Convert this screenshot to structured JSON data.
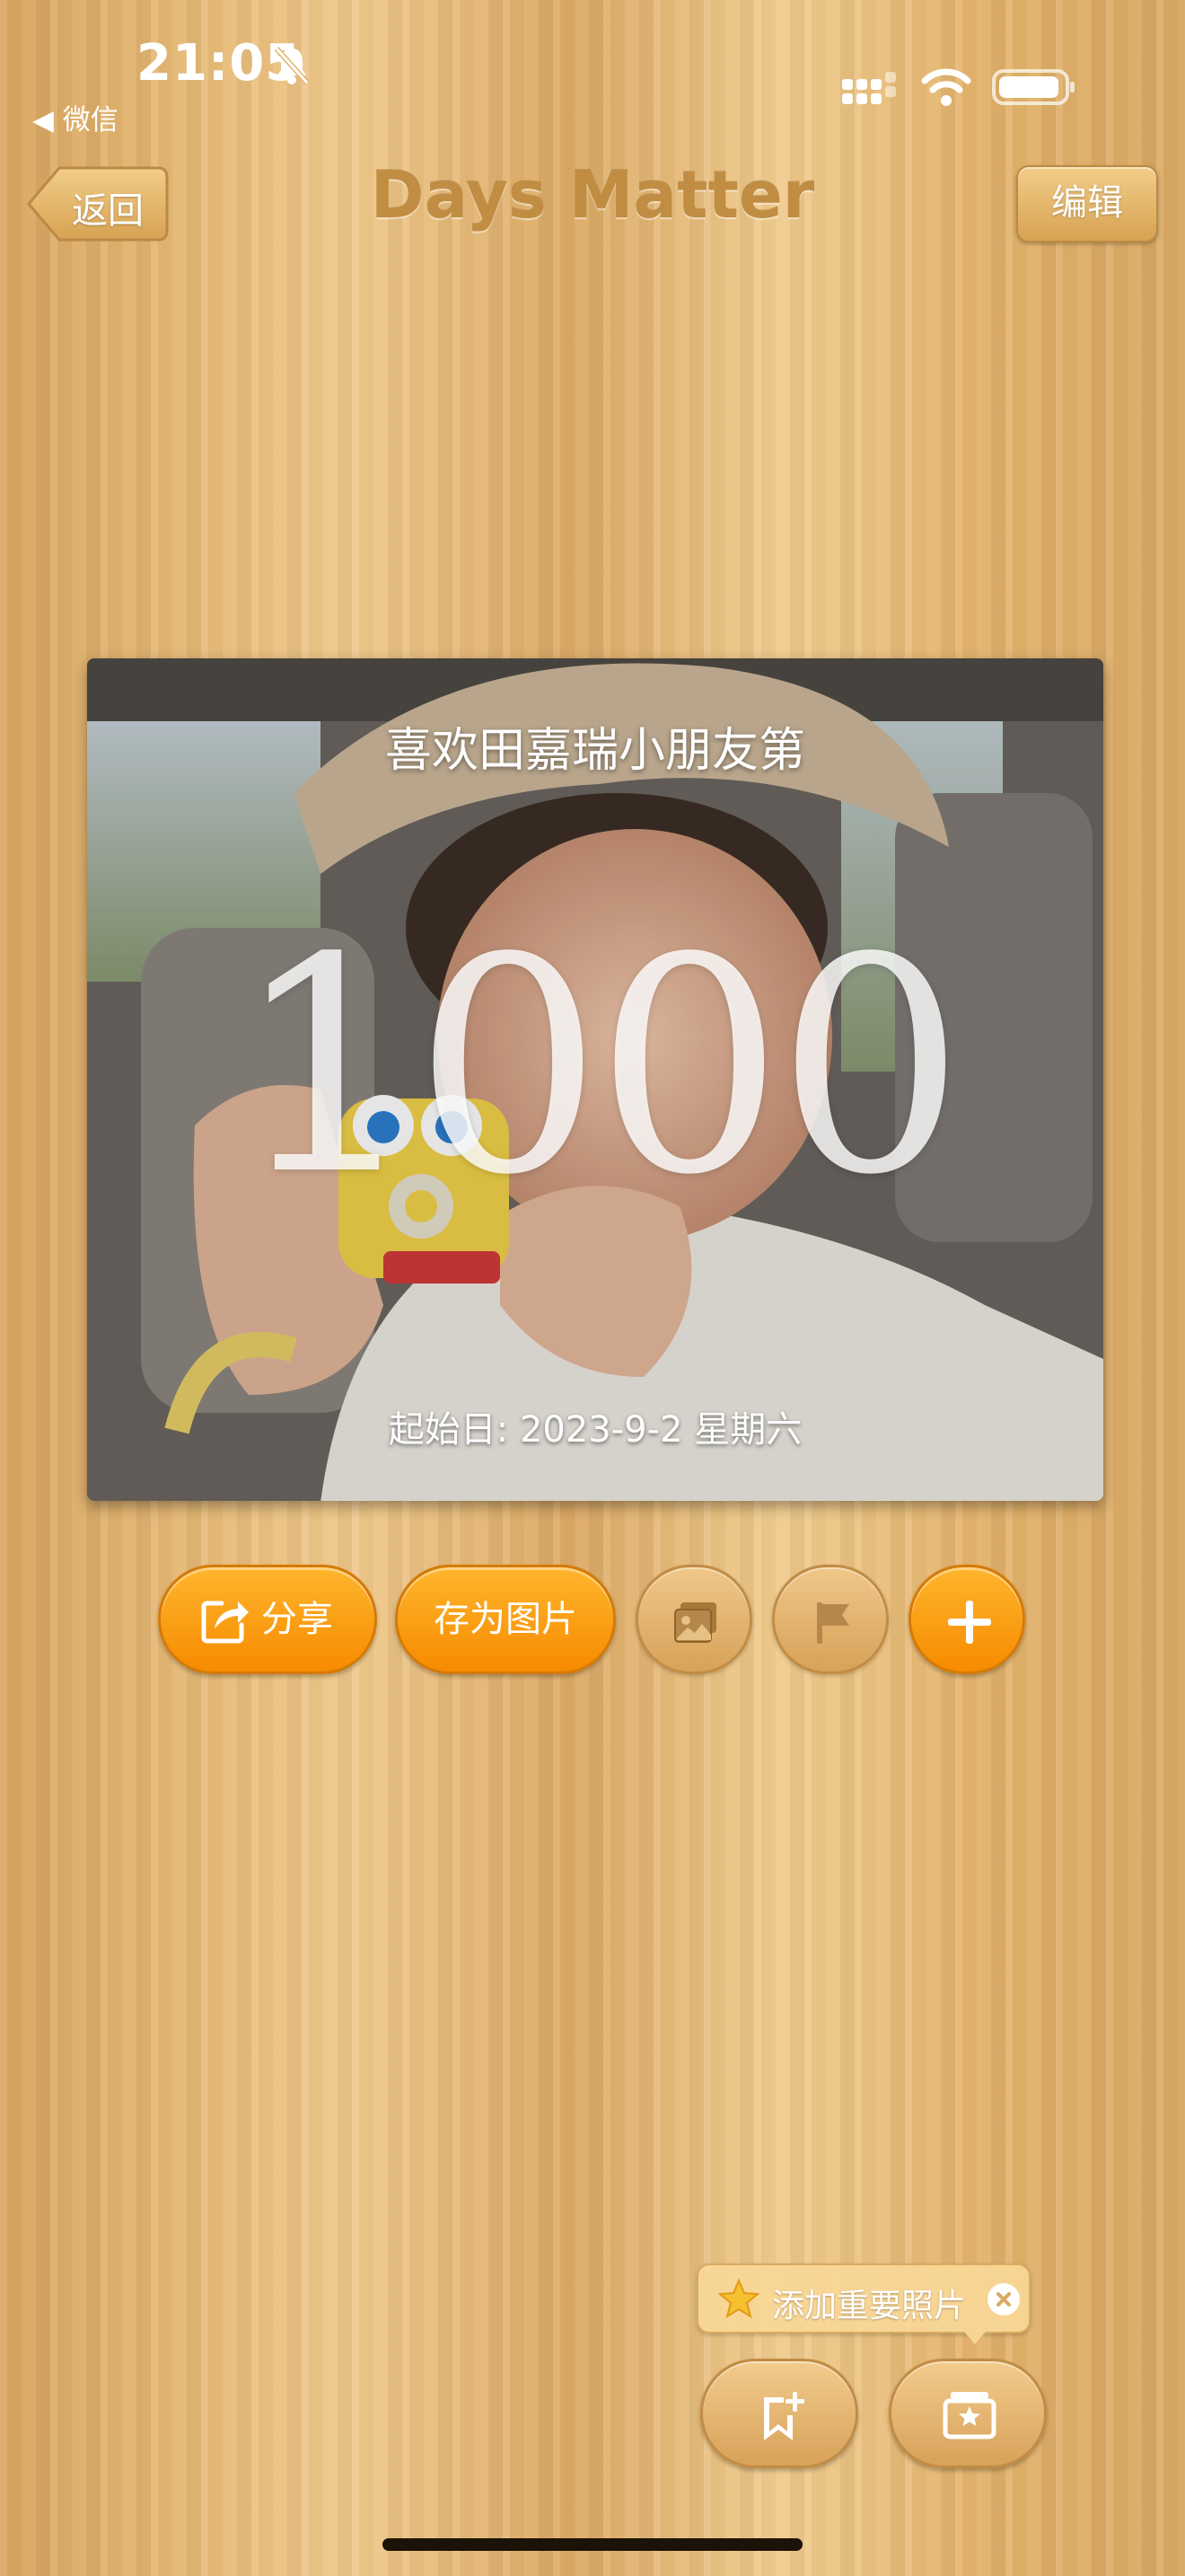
{
  "status_bar": {
    "time": "21:05",
    "back_app": "◀ 微信",
    "icons": [
      "bell-muted-icon",
      "signal-icon",
      "wifi-icon",
      "battery-icon"
    ]
  },
  "nav": {
    "back_label": "返回",
    "title": "Days Matter",
    "edit_label": "编辑"
  },
  "card": {
    "title": "喜欢田嘉瑞小朋友第",
    "days": "1000",
    "start_date": "起始日: 2023-9-2 星期六",
    "photo_icon": "photo-background"
  },
  "actions": {
    "share_label": "分享",
    "save_label": "存为图片",
    "icons": [
      "share-icon",
      "photo-icon",
      "flag-icon",
      "plus-icon"
    ]
  },
  "tooltip": {
    "text": "添加重要照片",
    "icons": [
      "star-icon",
      "close-icon"
    ]
  },
  "bottom": {
    "icons": [
      "bookmark-add-icon",
      "photo-frame-icon"
    ]
  },
  "colors": {
    "accent_orange": "#f68b00",
    "wood": "#e3b36d",
    "title": "#c08d43"
  }
}
